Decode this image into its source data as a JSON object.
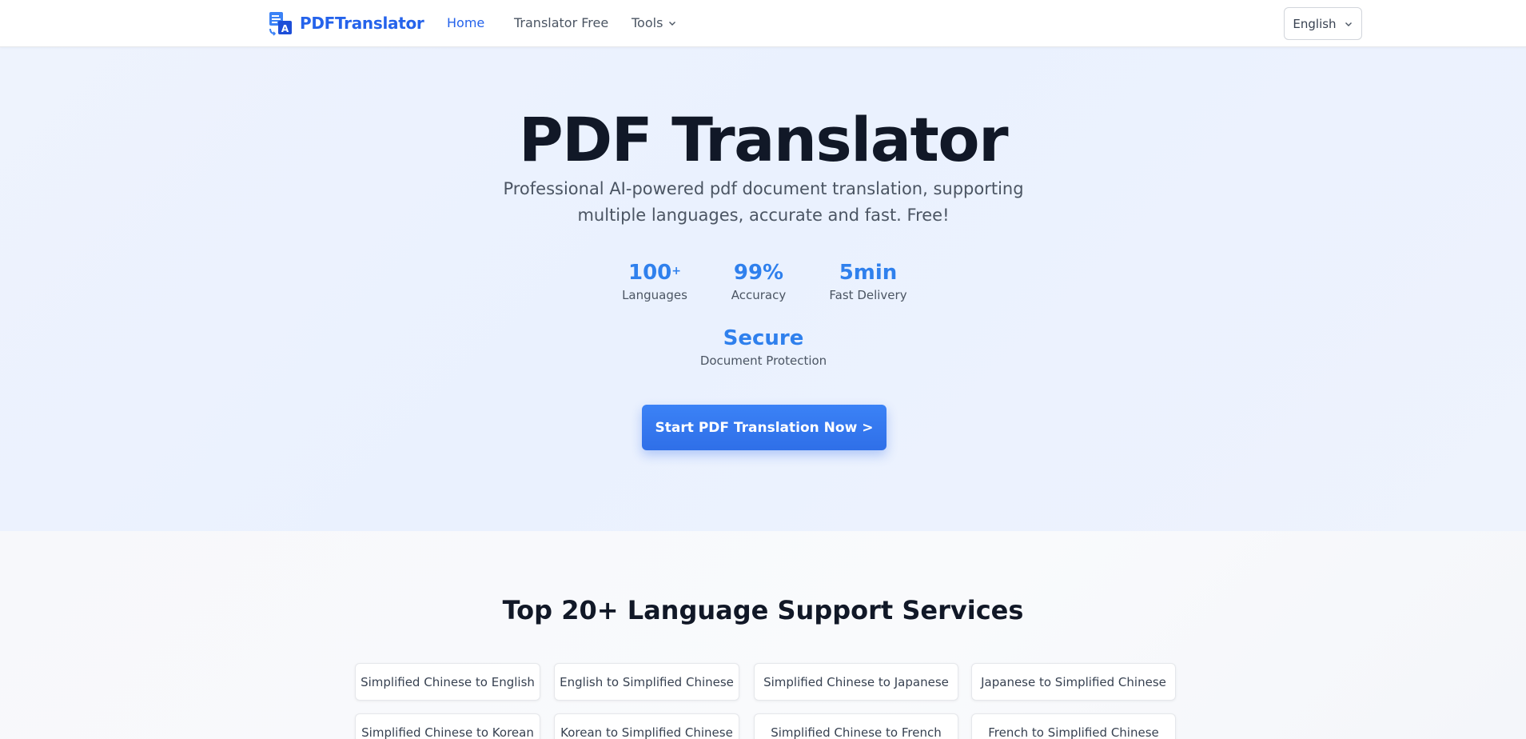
{
  "header": {
    "logo_text": "PDFTranslator",
    "nav": [
      {
        "label": "Home",
        "active": true
      },
      {
        "label": "Translator Free",
        "active": false
      },
      {
        "label": "Tools",
        "active": false,
        "has_dropdown": true
      }
    ],
    "language_select": "English"
  },
  "hero": {
    "title": "PDF Translator",
    "subtitle": "Professional AI-powered pdf document translation, supporting multiple languages, accurate and fast. Free!",
    "stats": [
      {
        "value": "100",
        "suffix": "+",
        "label": "Languages"
      },
      {
        "value": "99%",
        "suffix": "",
        "label": "Accuracy"
      },
      {
        "value": "5min",
        "suffix": "",
        "label": "Fast Delivery"
      },
      {
        "value": "Secure",
        "suffix": "",
        "label": "Document Protection"
      }
    ],
    "cta_label": "Start PDF Translation Now >"
  },
  "services": {
    "title": "Top 20+ Language Support Services",
    "items": [
      "Simplified Chinese to English",
      "English to Simplified Chinese",
      "Simplified Chinese to Japanese",
      "Japanese to Simplified Chinese",
      "Simplified Chinese to Korean",
      "Korean to Simplified Chinese",
      "Simplified Chinese to French",
      "French to Simplified Chinese"
    ]
  },
  "colors": {
    "accent": "#2563eb",
    "stat_blue": "#2f80ed",
    "hero_bg": "#eaf1fe",
    "text_dark": "#111827",
    "text_muted": "#4b5563"
  }
}
